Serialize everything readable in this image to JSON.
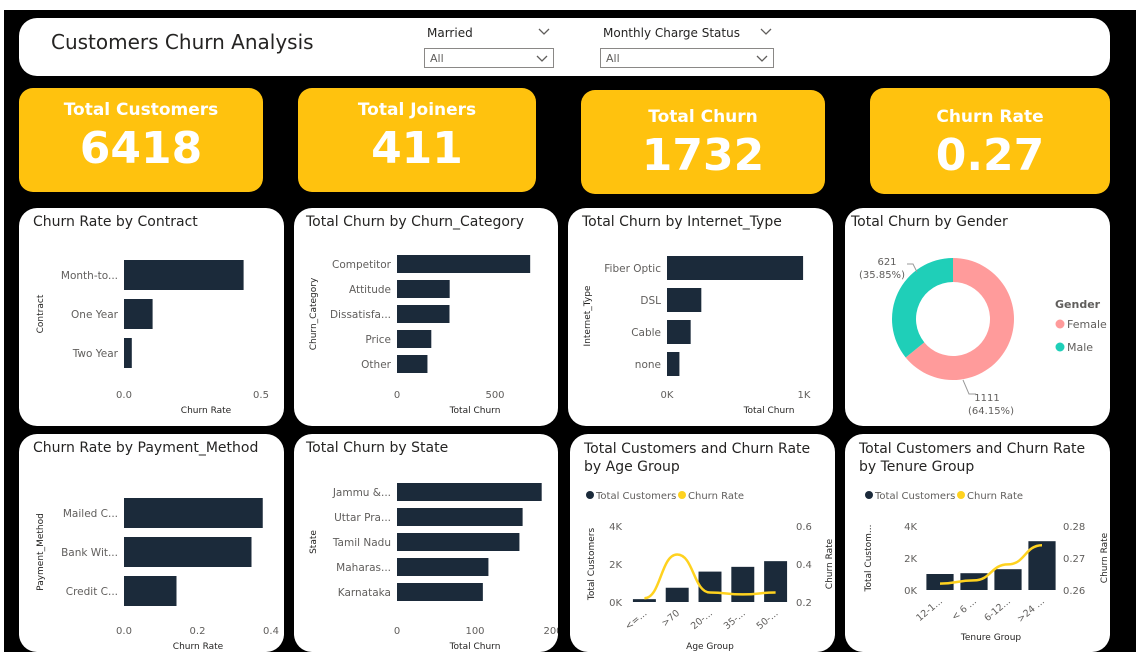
{
  "header": {
    "title": "Customers Churn Analysis",
    "filters": [
      {
        "label": "Married",
        "value": "All"
      },
      {
        "label": "Monthly Charge Status",
        "value": "All"
      }
    ]
  },
  "kpis": [
    {
      "label": "Total Customers",
      "value": "6418"
    },
    {
      "label": "Total Joiners",
      "value": "411"
    },
    {
      "label": "Total Churn",
      "value": "1732"
    },
    {
      "label": "Churn Rate",
      "value": "0.27"
    }
  ],
  "colors": {
    "bar": "#1B2A3A",
    "kpi": "#FFC20E",
    "female": "#FF9B9B",
    "male": "#1FCFB8",
    "line": "#FFD21F"
  },
  "chart_data": [
    {
      "id": "contract",
      "type": "bar",
      "orientation": "horizontal",
      "title": "Churn Rate by Contract",
      "categories": [
        "Month-to...",
        "One Year",
        "Two Year"
      ],
      "values": [
        0.46,
        0.11,
        0.03
      ],
      "xlabel": "Churn Rate",
      "ylabel": "Contract",
      "xlim": [
        0,
        0.5
      ],
      "xticks": [
        "0.0",
        "0.5"
      ]
    },
    {
      "id": "churn_category",
      "type": "bar",
      "orientation": "horizontal",
      "title": "Total Churn by Churn_Category",
      "categories": [
        "Competitor",
        "Attitude",
        "Dissatisfa...",
        "Price",
        "Other"
      ],
      "values": [
        761,
        301,
        300,
        196,
        174
      ],
      "xlabel": "Total Churn",
      "ylabel": "Churn_Category",
      "xlim": [
        0,
        800
      ],
      "xticks": [
        "0",
        "500"
      ]
    },
    {
      "id": "internet_type",
      "type": "bar",
      "orientation": "horizontal",
      "title": "Total Churn by Internet_Type",
      "categories": [
        "Fiber Optic",
        "DSL",
        "Cable",
        "none"
      ],
      "values": [
        1150,
        290,
        200,
        105
      ],
      "xlabel": "Total Churn",
      "ylabel": "Internet_Type",
      "xlim": [
        0,
        1200
      ],
      "xticks": [
        "0K",
        "1K"
      ]
    },
    {
      "id": "gender",
      "type": "pie",
      "variant": "donut",
      "title": "Total Churn by Gender",
      "legend_title": "Gender",
      "slices": [
        {
          "name": "Female",
          "value": 1111,
          "label": "1111",
          "pct": "(64.15%)"
        },
        {
          "name": "Male",
          "value": 621,
          "label": "621",
          "pct": "(35.85%)"
        }
      ]
    },
    {
      "id": "payment_method",
      "type": "bar",
      "orientation": "horizontal",
      "title": "Churn Rate by Payment_Method",
      "categories": [
        "Mailed C...",
        "Bank Wit...",
        "Credit C..."
      ],
      "values": [
        0.37,
        0.34,
        0.14
      ],
      "xlabel": "Churn Rate",
      "ylabel": "Payment_Method",
      "xlim": [
        0,
        0.4
      ],
      "xticks": [
        "0.0",
        "0.2",
        "0.4"
      ]
    },
    {
      "id": "state",
      "type": "bar",
      "orientation": "horizontal",
      "title": "Total Churn by State",
      "categories": [
        "Jammu &...",
        "Uttar Pra...",
        "Tamil Nadu",
        "Maharas...",
        "Karnataka"
      ],
      "values": [
        182,
        158,
        154,
        115,
        108
      ],
      "xlabel": "Total Churn",
      "ylabel": "State",
      "xlim": [
        0,
        200
      ],
      "xticks": [
        "0",
        "100",
        "200"
      ]
    },
    {
      "id": "age_group",
      "type": "bar+line",
      "title": "Total Customers and Churn Rate by Age Group",
      "legend": [
        "Total Customers",
        "Churn Rate"
      ],
      "categories": [
        "<=...",
        ">70",
        "20-...",
        "35-...",
        "50-..."
      ],
      "bars": [
        150,
        750,
        1600,
        1850,
        2150
      ],
      "line": [
        0.22,
        0.45,
        0.25,
        0.24,
        0.25
      ],
      "xlabel": "Age Group",
      "ylabel": "Total Customers",
      "y2label": "Churn Rate",
      "ylim": [
        0,
        4000
      ],
      "yticks": [
        "0K",
        "2K",
        "4K"
      ],
      "y2lim": [
        0.2,
        0.6
      ],
      "y2ticks": [
        "0.2",
        "0.4",
        "0.6"
      ]
    },
    {
      "id": "tenure_group",
      "type": "bar+line",
      "title": "Total Customers and Churn Rate by Tenure Group",
      "legend": [
        "Total Customers",
        "Churn Rate"
      ],
      "categories": [
        "12-1...",
        "< 6 ...",
        "6-12...",
        ">24 ..."
      ],
      "bars": [
        1000,
        1050,
        1300,
        3050
      ],
      "line": [
        0.262,
        0.263,
        0.268,
        0.274
      ],
      "xlabel": "Tenure Group",
      "ylabel": "Total Custom...",
      "y2label": "Churn Rate",
      "ylim": [
        0,
        4000
      ],
      "yticks": [
        "0K",
        "2K",
        "4K"
      ],
      "y2lim": [
        0.26,
        0.28
      ],
      "y2ticks": [
        "0.26",
        "0.27",
        "0.28"
      ]
    }
  ]
}
